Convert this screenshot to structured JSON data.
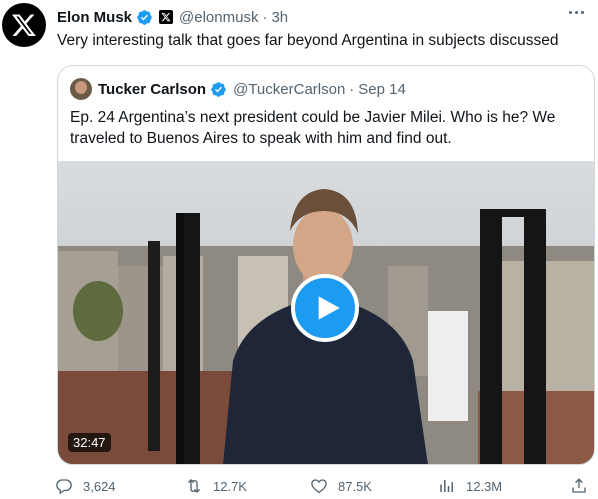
{
  "tweet": {
    "author_name": "Elon Musk",
    "author_handle": "@elonmusk",
    "separator": "·",
    "time": "3h",
    "text": "Very interesting talk that goes far beyond Argentina in subjects discussed"
  },
  "quoted": {
    "author_name": "Tucker Carlson",
    "author_handle": "@TuckerCarlson",
    "separator": "·",
    "time": "Sep 14",
    "text": "Ep. 24  Argentina’s next president could be Javier Milei. Who is he? We traveled to Buenos Aires to speak with him and find out.",
    "video_duration": "32:47"
  },
  "actions": {
    "replies": "3,624",
    "reposts": "12.7K",
    "likes": "87.5K",
    "views": "12.3M"
  },
  "colors": {
    "verified": "#1d9bf0",
    "play_button": "#1d9bf0",
    "muted_text": "#536471",
    "border": "#cfd9de"
  },
  "icons": [
    "x-logo-icon",
    "verified-icon",
    "more-icon",
    "play-icon",
    "reply-icon",
    "repost-icon",
    "like-icon",
    "views-icon",
    "share-icon"
  ]
}
